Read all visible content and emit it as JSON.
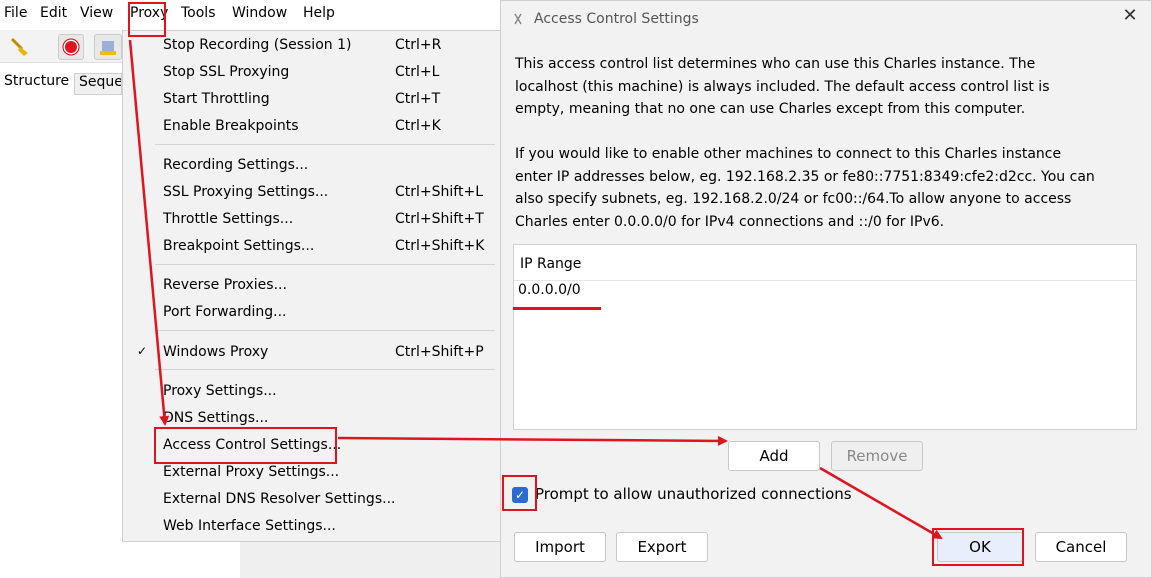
{
  "menubar": {
    "items": [
      "File",
      "Edit",
      "View",
      "Proxy",
      "Tools",
      "Window",
      "Help"
    ]
  },
  "toolbar": {
    "icons": [
      "broom-icon",
      "record-icon",
      "throttle-icon"
    ]
  },
  "tabs": [
    "Structure",
    "Seque"
  ],
  "proxy_menu": {
    "items": [
      {
        "label": "Stop Recording (Session 1)",
        "accel": "Ctrl+R"
      },
      {
        "label": "Stop SSL Proxying",
        "accel": "Ctrl+L"
      },
      {
        "label": "Start Throttling",
        "accel": "Ctrl+T"
      },
      {
        "label": "Enable Breakpoints",
        "accel": "Ctrl+K"
      },
      {
        "label": "Recording Settings...",
        "accel": ""
      },
      {
        "label": "SSL Proxying Settings...",
        "accel": "Ctrl+Shift+L"
      },
      {
        "label": "Throttle Settings...",
        "accel": "Ctrl+Shift+T"
      },
      {
        "label": "Breakpoint Settings...",
        "accel": "Ctrl+Shift+K"
      },
      {
        "label": "Reverse Proxies...",
        "accel": ""
      },
      {
        "label": "Port Forwarding...",
        "accel": ""
      },
      {
        "label": "Windows Proxy",
        "accel": "Ctrl+Shift+P",
        "checked": true
      },
      {
        "label": "Proxy Settings...",
        "accel": ""
      },
      {
        "label": "DNS Settings...",
        "accel": ""
      },
      {
        "label": "Access Control Settings...",
        "accel": ""
      },
      {
        "label": "External Proxy Settings...",
        "accel": ""
      },
      {
        "label": "External DNS Resolver Settings...",
        "accel": ""
      },
      {
        "label": "Web Interface Settings...",
        "accel": ""
      }
    ]
  },
  "dialog": {
    "title": "Access Control Settings",
    "para1": [
      "This access control list determines who can use this Charles instance. The",
      "localhost (this machine) is always included. The default access control list is",
      "empty, meaning that no one can use Charles except from this computer."
    ],
    "para2": [
      "If you would like to enable other machines to connect to this Charles instance",
      "enter IP addresses below, eg. 192.168.2.35 or fe80::7751:8349:cfe2:d2cc. You can",
      "also specify subnets, eg. 192.168.2.0/24 or fc00::/64.To allow anyone to access",
      "Charles enter 0.0.0.0/0 for IPv4 connections and ::/0 for IPv6."
    ],
    "table_header": "IP Range",
    "table_rows": [
      "0.0.0.0/0"
    ],
    "add_label": "Add",
    "remove_label": "Remove",
    "prompt_label": "Prompt to allow unauthorized connections",
    "import_label": "Import",
    "export_label": "Export",
    "ok_label": "OK",
    "cancel_label": "Cancel",
    "close_glyph": "✕"
  },
  "colors": {
    "annotation": "#e0141e",
    "checkbox": "#2a6ad3"
  }
}
